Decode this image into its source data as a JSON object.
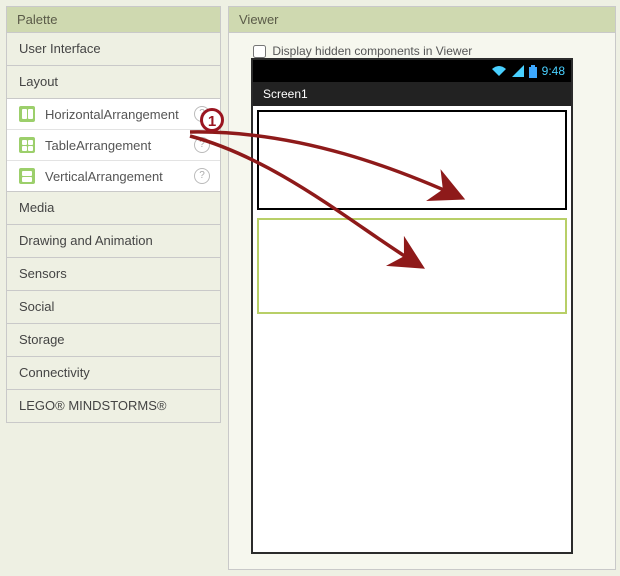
{
  "palette": {
    "title": "Palette",
    "categories": [
      {
        "label": "User Interface"
      },
      {
        "label": "Layout",
        "open": true,
        "items": [
          {
            "label": "HorizontalArrangement",
            "iconType": "h"
          },
          {
            "label": "TableArrangement",
            "iconType": "t"
          },
          {
            "label": "VerticalArrangement",
            "iconType": "v"
          }
        ]
      },
      {
        "label": "Media"
      },
      {
        "label": "Drawing and Animation"
      },
      {
        "label": "Sensors"
      },
      {
        "label": "Social"
      },
      {
        "label": "Storage"
      },
      {
        "label": "Connectivity"
      },
      {
        "label": "LEGO® MINDSTORMS®"
      }
    ]
  },
  "viewer": {
    "title": "Viewer",
    "hiddenComponentsLabel": "Display hidden components in Viewer",
    "hiddenComponentsChecked": false,
    "phone": {
      "time": "9:48",
      "screenTitle": "Screen1"
    }
  },
  "callout": {
    "number": "1"
  }
}
